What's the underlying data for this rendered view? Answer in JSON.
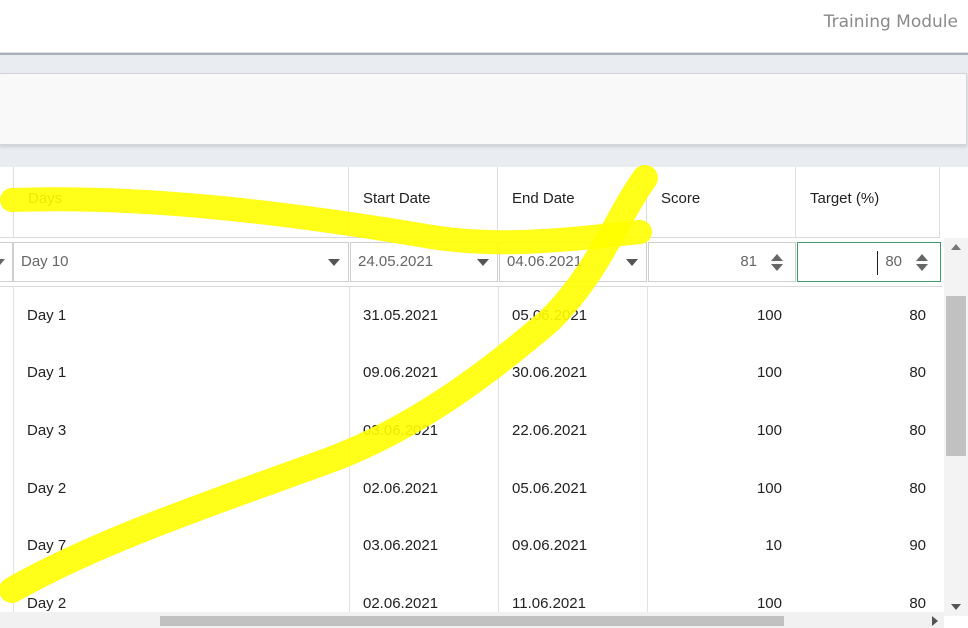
{
  "app": {
    "module_title": "Training Module"
  },
  "grid": {
    "columns": [
      "Days",
      "Start Date",
      "End Date",
      "Score",
      "Target (%)"
    ],
    "filter": {
      "days": "Day 10",
      "start_date": "24.05.2021",
      "end_date": "04.06.2021",
      "score": "81",
      "target": "80"
    },
    "rows": [
      {
        "days": "Day 1",
        "start": "31.05.2021",
        "end": "05.06.2021",
        "score": "100",
        "target": "80"
      },
      {
        "days": "Day 1",
        "start": "09.06.2021",
        "end": "30.06.2021",
        "score": "100",
        "target": "80"
      },
      {
        "days": "Day 3",
        "start": "03.06.2021",
        "end": "22.06.2021",
        "score": "100",
        "target": "80"
      },
      {
        "days": "Day 2",
        "start": "02.06.2021",
        "end": "05.06.2021",
        "score": "100",
        "target": "80"
      },
      {
        "days": "Day 7",
        "start": "03.06.2021",
        "end": "09.06.2021",
        "score": "10",
        "target": "90"
      },
      {
        "days": "Day 2",
        "start": "02.06.2021",
        "end": "11.06.2021",
        "score": "100",
        "target": "80"
      }
    ]
  },
  "colors": {
    "highlight": "#ffff00",
    "focus_border": "#3d9b6e",
    "module_title": "#8a8a8a"
  }
}
